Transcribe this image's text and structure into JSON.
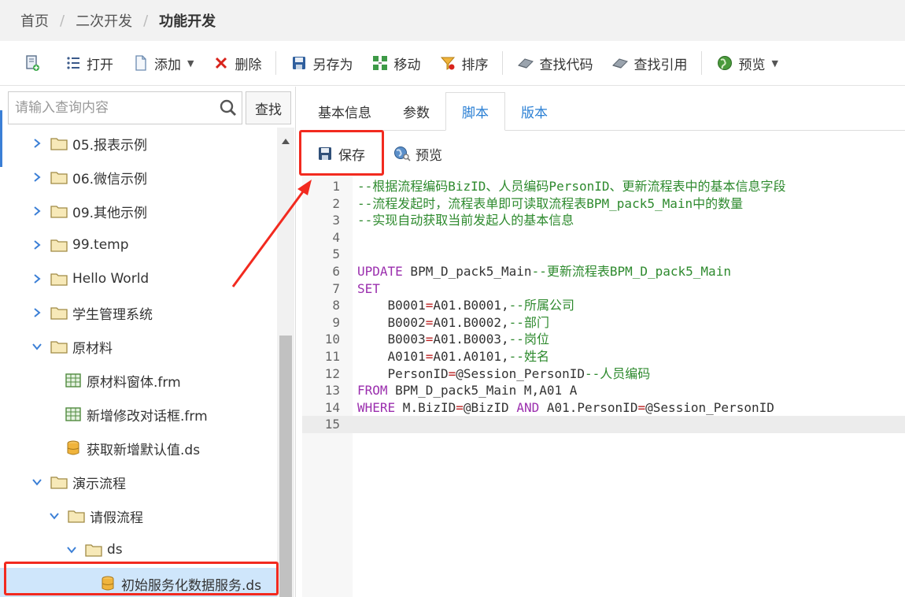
{
  "breadcrumb": {
    "items": [
      "首页",
      "二次开发",
      "功能开发"
    ],
    "separator": "/"
  },
  "toolbar": {
    "buttons": [
      {
        "label": "",
        "icon": "new-document-icon"
      },
      {
        "label": "打开",
        "icon": "list-icon"
      },
      {
        "label": "添加",
        "icon": "file-icon",
        "dropdown": true
      },
      {
        "label": "删除",
        "icon": "close-icon"
      },
      {
        "label": "另存为",
        "icon": "save-icon"
      },
      {
        "label": "移动",
        "icon": "move-icon"
      },
      {
        "label": "排序",
        "icon": "sort-icon"
      },
      {
        "label": "查找代码",
        "icon": "eraser-icon"
      },
      {
        "label": "查找引用",
        "icon": "eraser-icon"
      },
      {
        "label": "预览",
        "icon": "globe-icon",
        "dropdown": true
      }
    ]
  },
  "search": {
    "placeholder": "请输入查询内容",
    "button_label": "查找"
  },
  "tree": {
    "items": [
      {
        "label": "05.报表示例",
        "type": "folder",
        "expanded": false,
        "level": 0
      },
      {
        "label": "06.微信示例",
        "type": "folder",
        "expanded": false,
        "level": 0
      },
      {
        "label": "09.其他示例",
        "type": "folder",
        "expanded": false,
        "level": 0
      },
      {
        "label": "99.temp",
        "type": "folder",
        "expanded": false,
        "level": 0
      },
      {
        "label": "Hello World",
        "type": "folder",
        "expanded": false,
        "level": 0
      },
      {
        "label": "学生管理系统",
        "type": "folder",
        "expanded": false,
        "level": 0
      },
      {
        "label": "原材料",
        "type": "folder",
        "expanded": true,
        "level": 0
      },
      {
        "label": "原材料窗体.frm",
        "type": "form",
        "level": 1
      },
      {
        "label": "新增修改对话框.frm",
        "type": "form",
        "level": 1
      },
      {
        "label": "获取新增默认值.ds",
        "type": "dataservice",
        "level": 1
      },
      {
        "label": "演示流程",
        "type": "folder",
        "expanded": true,
        "level": 0
      },
      {
        "label": "请假流程",
        "type": "folder",
        "expanded": true,
        "level": 1
      },
      {
        "label": "ds",
        "type": "folder",
        "expanded": true,
        "level": 2
      },
      {
        "label": "初始服务化数据服务.ds",
        "type": "dataservice",
        "level": 3,
        "selected": true
      }
    ]
  },
  "tabs": [
    {
      "label": "基本信息",
      "state": "normal"
    },
    {
      "label": "参数",
      "state": "normal"
    },
    {
      "label": "脚本",
      "state": "active"
    },
    {
      "label": "版本",
      "state": "link"
    }
  ],
  "subbar": {
    "save_label": "保存",
    "preview_label": "预览"
  },
  "editor": {
    "lines": [
      {
        "n": "1",
        "tokens": [
          {
            "t": "--根据流程编码BizID、人员编码PersonID、更新流程表中的基本信息字段",
            "c": "comment"
          }
        ]
      },
      {
        "n": "2",
        "tokens": [
          {
            "t": "--流程发起时，流程表单即可读取流程表BPM_pack5_Main中的数量",
            "c": "comment"
          }
        ]
      },
      {
        "n": "3",
        "tokens": [
          {
            "t": "--实现自动获取当前发起人的基本信息",
            "c": "comment"
          }
        ]
      },
      {
        "n": "4",
        "tokens": []
      },
      {
        "n": "5",
        "tokens": []
      },
      {
        "n": "6",
        "tokens": [
          {
            "t": "UPDATE",
            "c": "keyword"
          },
          {
            "t": " BPM_D_pack5_Main",
            "c": "plain"
          },
          {
            "t": "--更新流程表BPM_D_pack5_Main",
            "c": "comment"
          }
        ]
      },
      {
        "n": "7",
        "tokens": [
          {
            "t": "SET",
            "c": "keyword"
          }
        ]
      },
      {
        "n": "8",
        "tokens": [
          {
            "t": "    B0001",
            "c": "plain"
          },
          {
            "t": "=",
            "c": "op"
          },
          {
            "t": "A01.B0001,",
            "c": "plain"
          },
          {
            "t": "--所属公司",
            "c": "comment"
          }
        ]
      },
      {
        "n": "9",
        "tokens": [
          {
            "t": "    B0002",
            "c": "plain"
          },
          {
            "t": "=",
            "c": "op"
          },
          {
            "t": "A01.B0002,",
            "c": "plain"
          },
          {
            "t": "--部门",
            "c": "comment"
          }
        ]
      },
      {
        "n": "10",
        "tokens": [
          {
            "t": "    B0003",
            "c": "plain"
          },
          {
            "t": "=",
            "c": "op"
          },
          {
            "t": "A01.B0003,",
            "c": "plain"
          },
          {
            "t": "--岗位",
            "c": "comment"
          }
        ]
      },
      {
        "n": "11",
        "tokens": [
          {
            "t": "    A0101",
            "c": "plain"
          },
          {
            "t": "=",
            "c": "op"
          },
          {
            "t": "A01.A0101,",
            "c": "plain"
          },
          {
            "t": "--姓名",
            "c": "comment"
          }
        ]
      },
      {
        "n": "12",
        "tokens": [
          {
            "t": "    PersonID",
            "c": "plain"
          },
          {
            "t": "=",
            "c": "op"
          },
          {
            "t": "@Session_PersonID",
            "c": "plain"
          },
          {
            "t": "--人员编码",
            "c": "comment"
          }
        ]
      },
      {
        "n": "13",
        "tokens": [
          {
            "t": "FROM",
            "c": "keyword"
          },
          {
            "t": " BPM_D_pack5_Main M,A01 A",
            "c": "plain"
          }
        ]
      },
      {
        "n": "14",
        "tokens": [
          {
            "t": "WHERE",
            "c": "keyword"
          },
          {
            "t": " M.BizID",
            "c": "plain"
          },
          {
            "t": "=",
            "c": "op"
          },
          {
            "t": "@BizID ",
            "c": "plain"
          },
          {
            "t": "AND",
            "c": "keyword"
          },
          {
            "t": " A01.PersonID",
            "c": "plain"
          },
          {
            "t": "=",
            "c": "op"
          },
          {
            "t": "@Session_PersonID",
            "c": "plain"
          }
        ]
      },
      {
        "n": "15",
        "tokens": [],
        "current": true
      }
    ]
  },
  "colors": {
    "accent": "#2a7fd4",
    "highlight_red": "#f22a1f",
    "selected_row": "#cfe6fb",
    "comment_green": "#2e8a2e",
    "keyword_purple": "#9b2fae"
  }
}
